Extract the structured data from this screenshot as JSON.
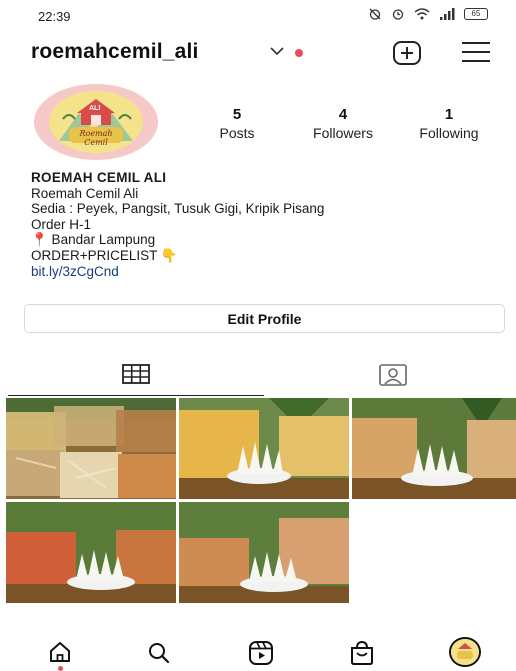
{
  "status_bar": {
    "time": "22:39",
    "battery": "65",
    "icons": [
      "alarm-off-icon",
      "alarm-icon",
      "wifi-icon",
      "signal-icon",
      "battery-icon"
    ]
  },
  "header": {
    "username": "roemahcemil_ali",
    "icons": [
      "chevron-down-icon",
      "new-post-icon",
      "menu-icon"
    ],
    "accent": "#ed4956"
  },
  "avatar": {
    "logo_text_top": "ALI",
    "logo_text_script": "Roemah Cemil",
    "colors": {
      "ring": "#f6c9c8",
      "fill": "#f4e38a"
    }
  },
  "stats": [
    {
      "value": "5",
      "label": "Posts"
    },
    {
      "value": "4",
      "label": "Followers"
    },
    {
      "value": "1",
      "label": "Following"
    }
  ],
  "bio": {
    "name": "ROEMAH CEMIL ALI",
    "lines": [
      "Roemah Cemil Ali",
      "Sedia : Peyek, Pangsit, Tusuk Gigi, Kripik Pisang",
      "Order H-1",
      "📍 Bandar Lampung",
      "ORDER+PRICELIST 👇"
    ],
    "link": "bit.ly/3zCgCnd",
    "link_color": "#1b3c76"
  },
  "edit_profile": {
    "label": "Edit Profile"
  },
  "tabs": [
    {
      "name": "posts-grid",
      "icon": "grid-icon",
      "active": true
    },
    {
      "name": "tagged",
      "icon": "tagged-person-icon",
      "active": false
    }
  ],
  "posts": [
    {
      "scene": "snack-bags-on-table"
    },
    {
      "scene": "snacks-with-coral-decor"
    },
    {
      "scene": "snacks-with-coral-decor"
    },
    {
      "scene": "red-chips-with-coral-decor"
    },
    {
      "scene": "chips-with-coral-decor"
    }
  ],
  "bottom_nav": [
    {
      "icon": "home-icon",
      "active": true
    },
    {
      "icon": "search-icon"
    },
    {
      "icon": "reels-icon"
    },
    {
      "icon": "shop-icon"
    },
    {
      "icon": "profile-avatar-icon"
    }
  ]
}
